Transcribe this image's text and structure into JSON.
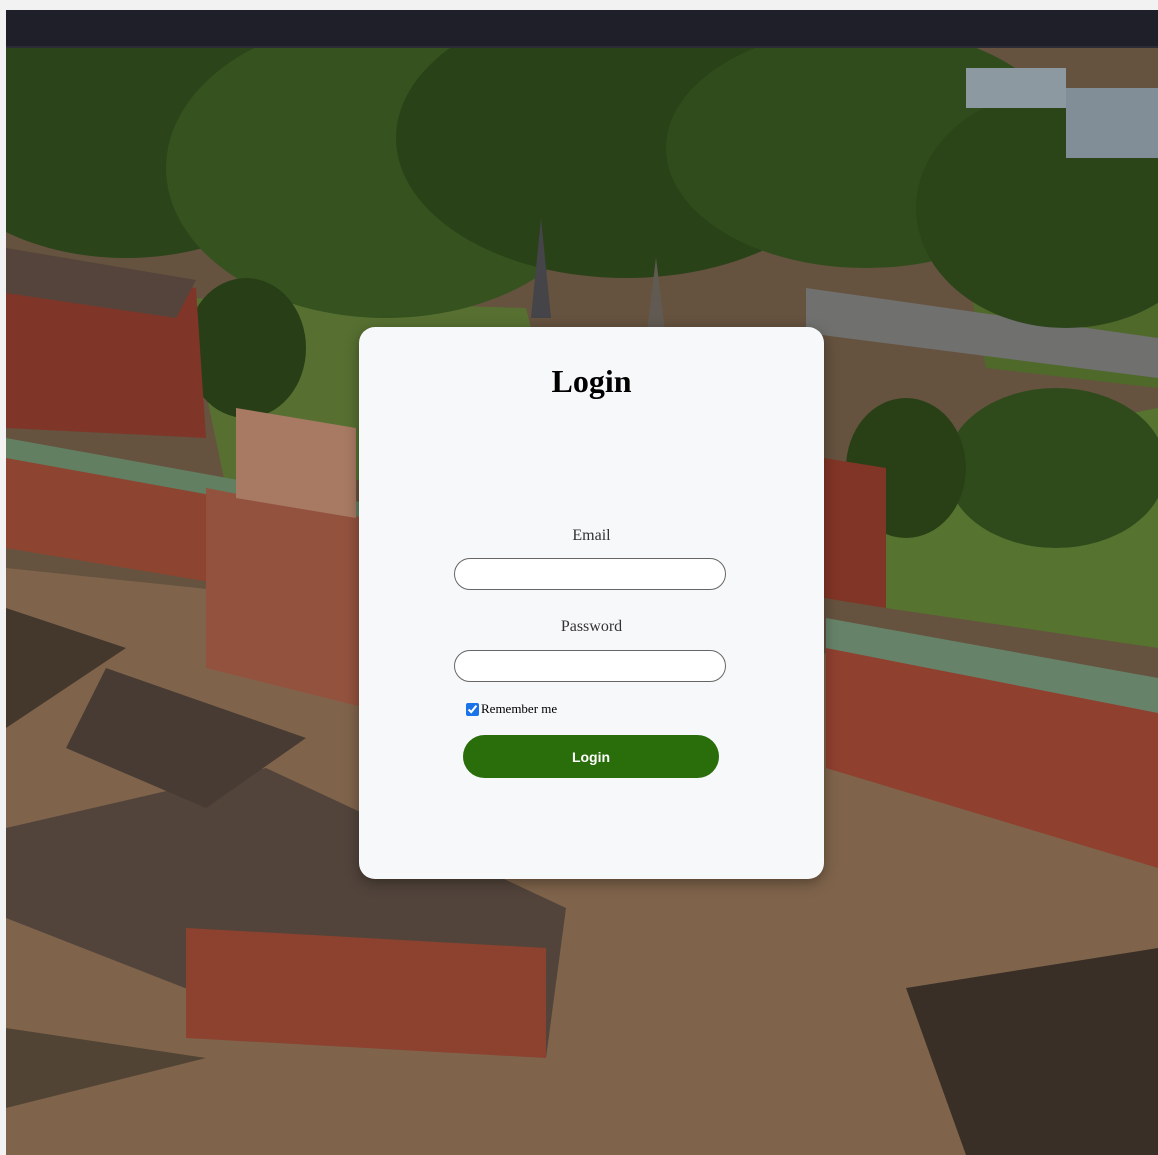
{
  "login": {
    "title": "Login",
    "email_label": "Email",
    "email_value": "",
    "password_label": "Password",
    "password_value": "",
    "remember_label": "Remember me",
    "remember_checked": true,
    "button_label": "Login"
  },
  "colors": {
    "navbar": "#1f1f29",
    "card": "#f7f8fa",
    "button": "#2a6e0c",
    "checkbox": "#1a73e8"
  }
}
